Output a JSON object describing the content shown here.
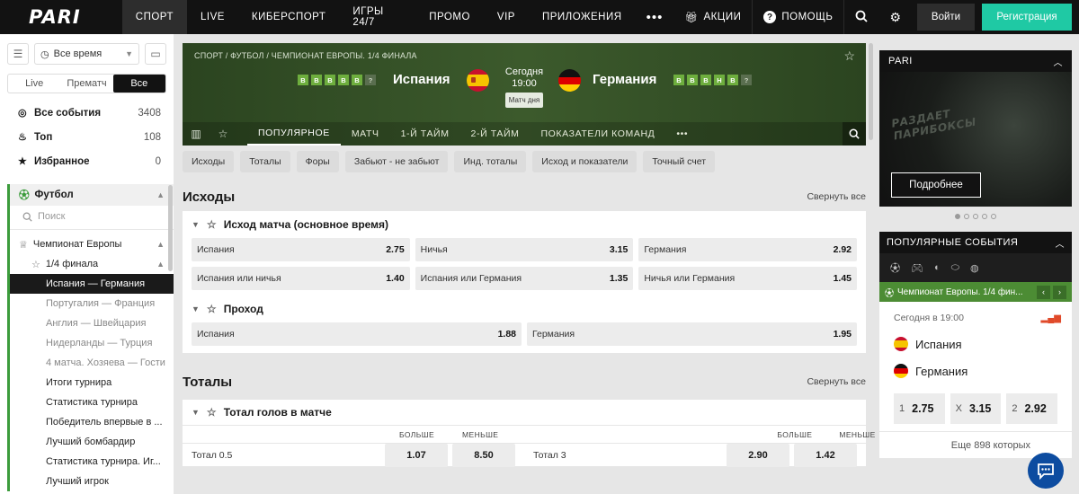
{
  "brand": {
    "logo": "PARI"
  },
  "nav": {
    "items": [
      "СПОРТ",
      "LIVE",
      "КИБЕРСПОРТ",
      "ИГРЫ 24/7",
      "ПРОМО",
      "VIP",
      "ПРИЛОЖЕНИЯ"
    ],
    "promos": "АКЦИИ",
    "help": "ПОМОЩЬ",
    "login": "Войти",
    "register": "Регистрация"
  },
  "sidebar": {
    "time_filter": "Все время",
    "segments": [
      "Live",
      "Прематч",
      "Все"
    ],
    "main": [
      {
        "label": "Все события",
        "count": "3408"
      },
      {
        "label": "Топ",
        "count": "108"
      },
      {
        "label": "Избранное",
        "count": "0"
      }
    ],
    "sport": "Футбол",
    "search_placeholder": "Поиск",
    "tournament": "Чемпионат Европы",
    "stage": "1/4 финала",
    "matches": [
      "Испания — Германия",
      "Португалия — Франция",
      "Англия — Швейцария",
      "Нидерланды — Турция",
      "4 матча. Хозяева — Гости"
    ],
    "more": [
      "Итоги турнира",
      "Статистика турнира",
      "Победитель впервые в ...",
      "Лучший бомбардир",
      "Статистика турнира. Иг...",
      "Лучший игрок"
    ]
  },
  "match": {
    "breadcrumb": "СПОРТ / ФУТБОЛ / ЧЕМПИОНАТ ЕВРОПЫ. 1/4 ФИНАЛА",
    "home": "Испания",
    "away": "Германия",
    "home_form": [
      "В",
      "В",
      "В",
      "В",
      "В",
      "?"
    ],
    "away_form": [
      "В",
      "В",
      "В",
      "Н",
      "В",
      "?"
    ],
    "day": "Сегодня",
    "time": "19:00",
    "badge": "Матч дня",
    "tabs": [
      "ПОПУЛЯРНОЕ",
      "МАТЧ",
      "1-Й ТАЙМ",
      "2-Й ТАЙМ",
      "ПОКАЗАТЕЛИ КОМАНД"
    ]
  },
  "chips": [
    "Исходы",
    "Тоталы",
    "Форы",
    "Забьют - не забьют",
    "Инд. тоталы",
    "Исход и показатели",
    "Точный счет"
  ],
  "outcomes": {
    "title": "Исходы",
    "collapse": "Свернуть все",
    "main_title": "Исход матча (основное время)",
    "main": [
      {
        "l": "Испания",
        "v": "2.75"
      },
      {
        "l": "Ничья",
        "v": "3.15"
      },
      {
        "l": "Германия",
        "v": "2.92"
      },
      {
        "l": "Испания или ничья",
        "v": "1.40"
      },
      {
        "l": "Испания или Германия",
        "v": "1.35"
      },
      {
        "l": "Ничья или Германия",
        "v": "1.45"
      }
    ],
    "pass_title": "Проход",
    "pass": [
      {
        "l": "Испания",
        "v": "1.88"
      },
      {
        "l": "Германия",
        "v": "1.95"
      }
    ]
  },
  "totals": {
    "title": "Тоталы",
    "collapse": "Свернуть все",
    "card_title": "Тотал голов в матче",
    "over": "БОЛЬШЕ",
    "under": "МЕНЬШЕ",
    "rows": [
      {
        "l": "Тотал 0.5",
        "o": "1.07",
        "u": "8.50",
        "l2": "Тотал 3",
        "o2": "2.90",
        "u2": "1.42"
      }
    ]
  },
  "promo": {
    "title": "PARI",
    "art_text": "РАЗДАЕТ ПАРИБОКСЫ",
    "button": "Подробнее"
  },
  "popular": {
    "title": "ПОПУЛЯРНЫЕ СОБЫТИЯ",
    "champ": "Чемпионат Европы. 1/4 фин...",
    "time": "Сегодня в 19:00",
    "home": "Испания",
    "away": "Германия",
    "odds": [
      {
        "k": "1",
        "v": "2.75"
      },
      {
        "k": "X",
        "v": "3.15"
      },
      {
        "k": "2",
        "v": "2.92"
      }
    ],
    "more": "Еще 898 которых"
  },
  "colors": {
    "accent": "#1fc9a4",
    "green": "#3c9c3c",
    "dark": "#121212",
    "chat": "#0d4ca0"
  }
}
